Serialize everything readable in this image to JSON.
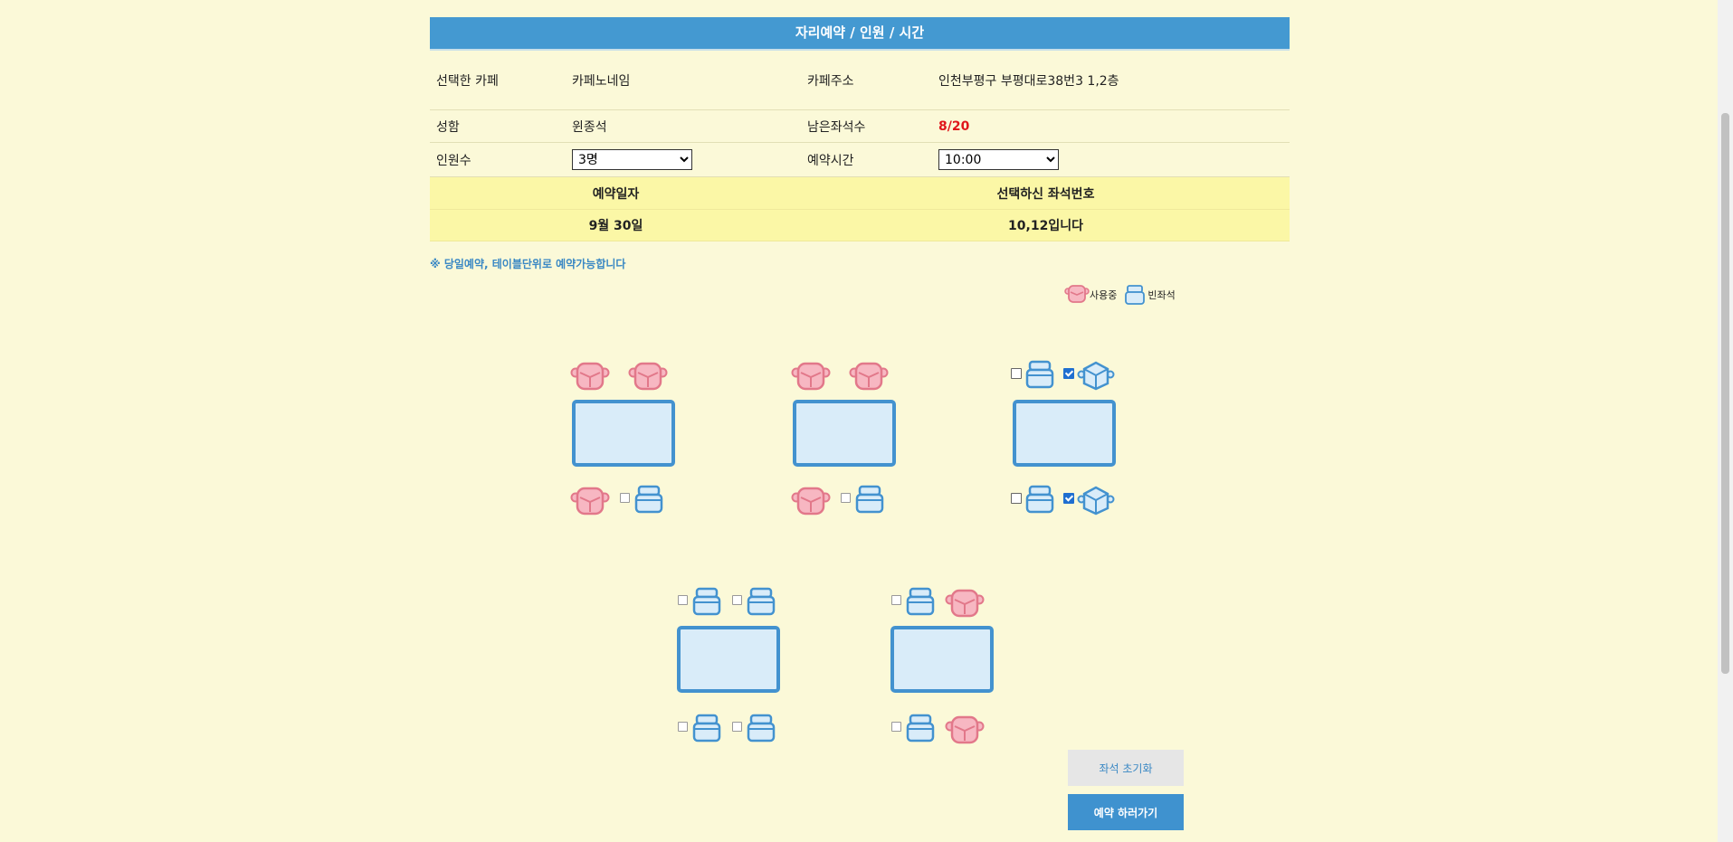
{
  "header": {
    "title": "자리예약 / 인원 / 시간"
  },
  "info": {
    "cafe_label": "선택한 카페",
    "cafe_value": "카페노네임",
    "address_label": "카페주소",
    "address_value": "인천부평구 부평대로38번3 1,2층",
    "name_label": "성함",
    "name_value": "윈종석",
    "remaining_label": "남은좌석수",
    "remaining_value": "8/20",
    "people_label": "인원수",
    "people_value": "3명",
    "time_label": "예약시간",
    "time_value": "10:00",
    "date_label": "예약일자",
    "date_value": "9월 30일",
    "seat_label": "선택하신 좌석번호",
    "seat_value": "10,12입니다"
  },
  "notice": "※ 당일예약, 테이블단위로 예약가능합니다",
  "legend": {
    "occupied": "사용중",
    "empty": "빈좌석"
  },
  "seats": [
    {
      "state": "occupied"
    },
    {
      "state": "occupied"
    },
    {
      "state": "occupied"
    },
    {
      "state": "empty",
      "checked": false
    },
    {
      "state": "occupied"
    },
    {
      "state": "occupied"
    },
    {
      "state": "occupied"
    },
    {
      "state": "empty",
      "checked": false
    },
    {
      "state": "empty",
      "checked": false
    },
    {
      "state": "selected",
      "checked": true
    },
    {
      "state": "empty",
      "checked": false
    },
    {
      "state": "selected",
      "checked": true
    },
    {
      "state": "empty",
      "checked": false
    },
    {
      "state": "empty",
      "checked": false
    },
    {
      "state": "empty",
      "checked": false
    },
    {
      "state": "empty",
      "checked": false
    },
    {
      "state": "empty",
      "checked": false
    },
    {
      "state": "occupied"
    },
    {
      "state": "empty",
      "checked": false
    },
    {
      "state": "occupied"
    }
  ],
  "buttons": {
    "reset": "좌석 초기화",
    "reserve": "예약 하러가기"
  },
  "colors": {
    "header": "#4499d1",
    "background": "#fbf9d8",
    "highlight": "#fbf7a6",
    "remaining": "#e0161b"
  }
}
